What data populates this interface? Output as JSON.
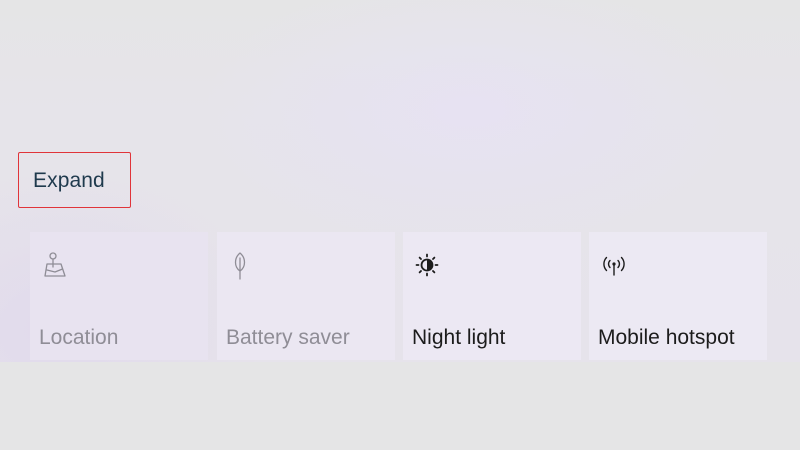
{
  "expand": {
    "label": "Expand"
  },
  "tiles": [
    {
      "label": "Location",
      "icon": "location-icon",
      "state": "off"
    },
    {
      "label": "Battery saver",
      "icon": "leaf-icon",
      "state": "off"
    },
    {
      "label": "Night light",
      "icon": "brightness-icon",
      "state": "on"
    },
    {
      "label": "Mobile hotspot",
      "icon": "hotspot-icon",
      "state": "on"
    }
  ],
  "colors": {
    "highlight_border": "#e0343a",
    "disabled_text": "#8f8d96",
    "active_text": "#1c1c1c",
    "link_text": "#1f3a4d"
  }
}
